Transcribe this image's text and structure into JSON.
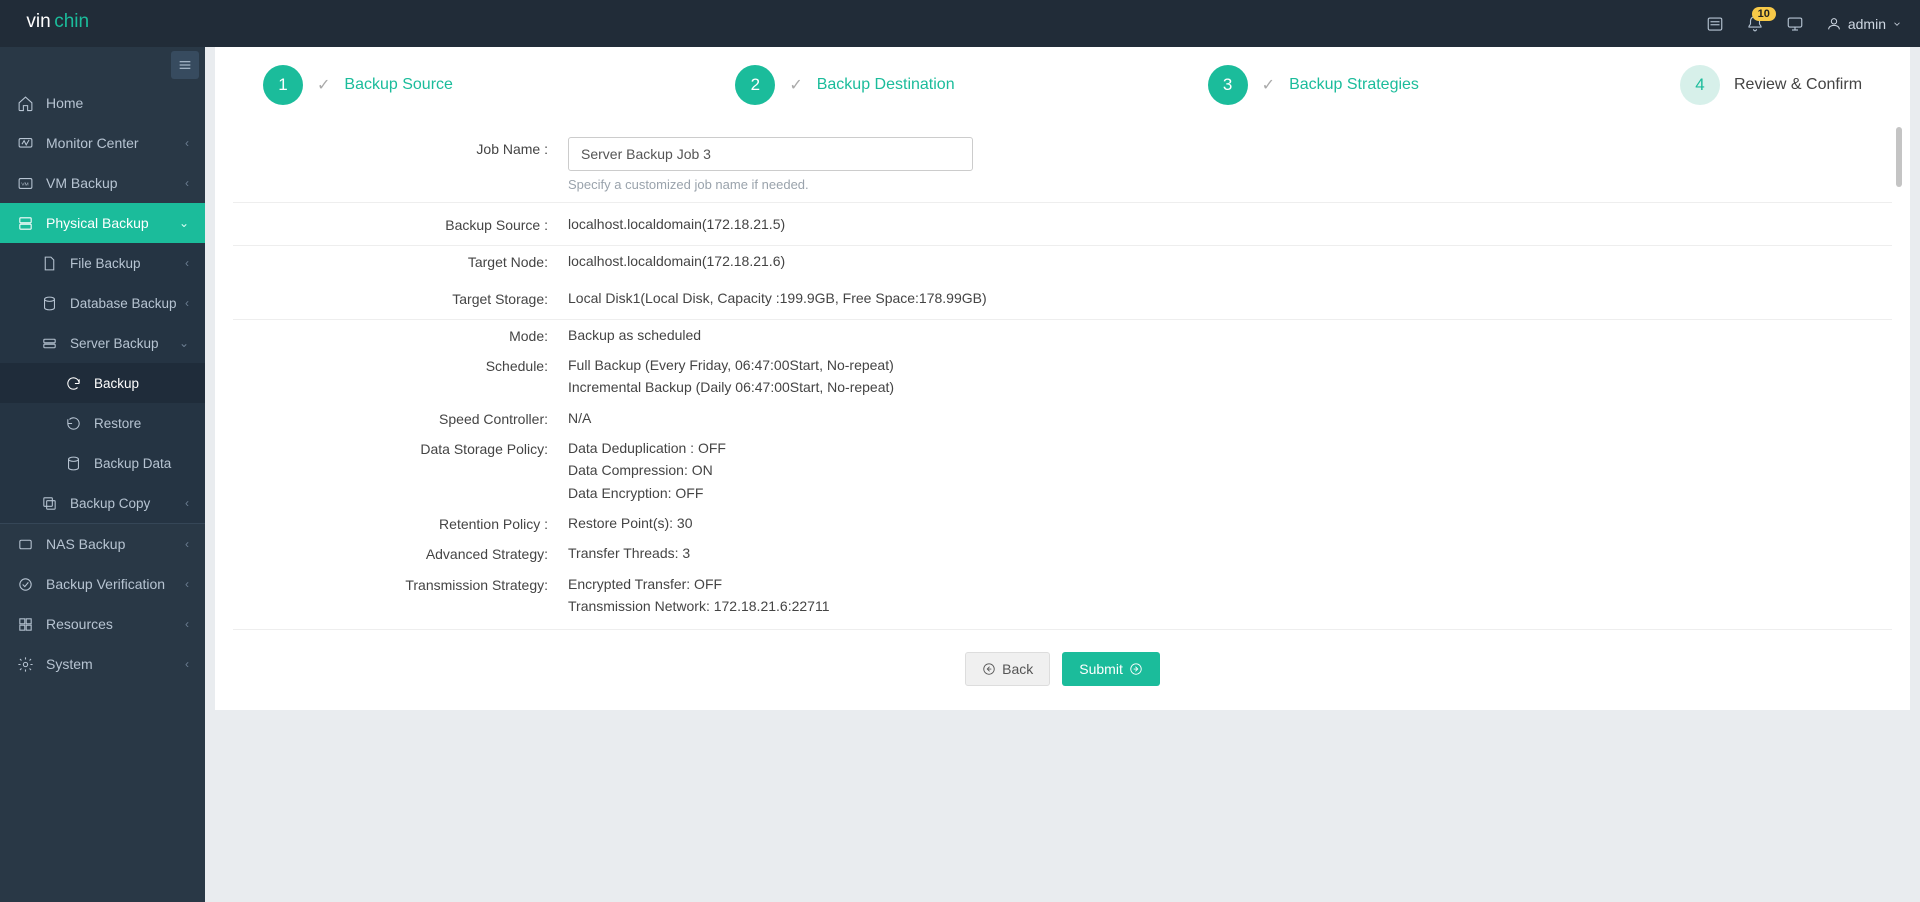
{
  "topbar": {
    "logo_alt": "vinchin",
    "notification_count": "10",
    "user": "admin"
  },
  "sidebar": {
    "home": "Home",
    "monitor": "Monitor Center",
    "vm_backup": "VM Backup",
    "physical_backup": "Physical Backup",
    "file_backup": "File Backup",
    "database_backup": "Database Backup",
    "server_backup": "Server Backup",
    "backup": "Backup",
    "restore": "Restore",
    "backup_data": "Backup Data",
    "backup_copy": "Backup Copy",
    "nas_backup": "NAS Backup",
    "backup_verification": "Backup Verification",
    "resources": "Resources",
    "system": "System"
  },
  "steps": {
    "s1": {
      "num": "1",
      "label": "Backup Source"
    },
    "s2": {
      "num": "2",
      "label": "Backup Destination"
    },
    "s3": {
      "num": "3",
      "label": "Backup Strategies"
    },
    "s4": {
      "num": "4",
      "label": "Review & Confirm"
    }
  },
  "form": {
    "job_name_label": "Job Name :",
    "job_name_value": "Server Backup Job 3",
    "job_name_hint": "Specify a customized job name if needed.",
    "backup_source_label": "Backup Source :",
    "backup_source_value": "localhost.localdomain(172.18.21.5)",
    "target_node_label": "Target Node:",
    "target_node_value": "localhost.localdomain(172.18.21.6)",
    "target_storage_label": "Target Storage:",
    "target_storage_value": "Local Disk1(Local Disk, Capacity :199.9GB, Free Space:178.99GB)",
    "mode_label": "Mode:",
    "mode_value": "Backup as scheduled",
    "schedule_label": "Schedule:",
    "schedule_line1": "Full Backup (Every Friday, 06:47:00Start, No-repeat)",
    "schedule_line2": "Incremental Backup (Daily 06:47:00Start, No-repeat)",
    "speed_label": "Speed Controller:",
    "speed_value": "N/A",
    "storage_policy_label": "Data Storage Policy:",
    "storage_policy_l1": "Data Deduplication : OFF",
    "storage_policy_l2": "Data Compression: ON",
    "storage_policy_l3": "Data Encryption: OFF",
    "retention_label": "Retention Policy :",
    "retention_value": "Restore Point(s): 30",
    "advanced_label": "Advanced Strategy:",
    "advanced_value": "Transfer Threads: 3",
    "transmission_label": "Transmission Strategy:",
    "transmission_l1": "Encrypted Transfer: OFF",
    "transmission_l2": "Transmission Network: 172.18.21.6:22711"
  },
  "footer": {
    "back": "Back",
    "submit": "Submit"
  }
}
